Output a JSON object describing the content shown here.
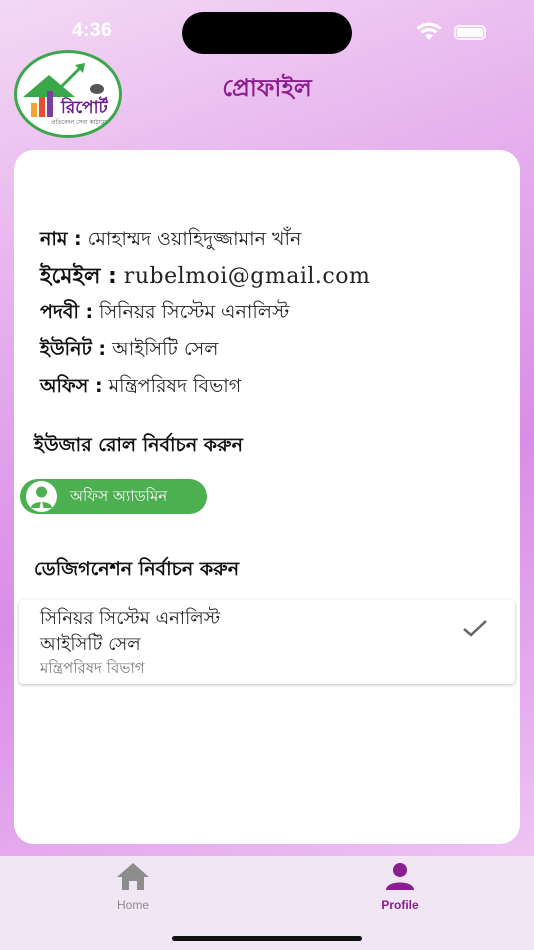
{
  "status_bar": {
    "time": "4:36"
  },
  "logo": {
    "text": "রিপোর্ট",
    "subtitle": "প্রতিবেদন সেবা কাঠামো"
  },
  "header": {
    "title": "প্রোফাইল"
  },
  "profile": {
    "name_label": "নাম :",
    "name_value": "মোহাম্মদ ওয়াহিদুজ্জামান খাঁন",
    "email_label": "ইমেইল :",
    "email_value": "rubelmoi@gmail.com",
    "post_label": "পদবী :",
    "post_value": "সিনিয়র সিস্টেম এনালিস্ট",
    "unit_label": "ইউনিট :",
    "unit_value": "আইসিটি সেল",
    "office_label": "অফিস :",
    "office_value": "মন্ত্রিপরিষদ বিভাগ"
  },
  "role_section": {
    "heading": "ইউজার রোল নির্বাচন করুন",
    "selected_role": "অফিস অ্যাডমিন",
    "chip_color": "#4caf50"
  },
  "designation_section": {
    "heading": "ডেজিগনেশন নির্বাচন করুন",
    "items": [
      {
        "designation": "সিনিয়র সিস্টেম এনালিস্ট",
        "unit": "আইসিটি সেল",
        "office": "মন্ত্রিপরিষদ বিভাগ",
        "selected": true
      }
    ]
  },
  "bottom_nav": {
    "items": [
      {
        "label": "Home",
        "icon": "home-icon",
        "active": false
      },
      {
        "label": "Profile",
        "icon": "person-icon",
        "active": true
      }
    ],
    "active_color": "#8c1f8f",
    "inactive_color": "#8d8d8d"
  }
}
